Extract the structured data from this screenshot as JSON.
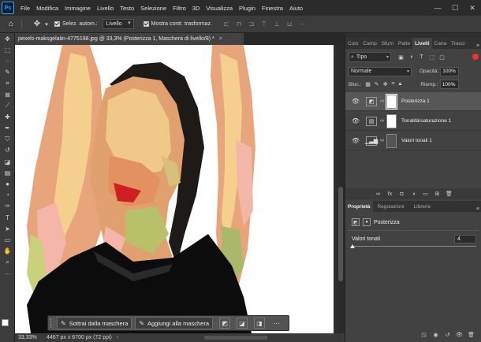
{
  "app": {
    "logo": "Ps"
  },
  "menu": [
    "File",
    "Modifica",
    "Immagine",
    "Livello",
    "Testo",
    "Selezione",
    "Filtro",
    "3D",
    "Visualizza",
    "Plugin",
    "Finestra",
    "Aiuto"
  ],
  "window_controls": {
    "minimize": "—",
    "maximize": "☐",
    "close": "✕"
  },
  "options": {
    "auto_select_label": "Selez. autom.:",
    "auto_select_value": "Livello",
    "show_transform_label": "Mostra contr. trasformaz."
  },
  "document": {
    "tab_title": "pexels-maksgelatin-4775198.jpg @ 33,3% (Posterizza 1, Maschera di livello/8) *",
    "close": "×"
  },
  "maskbar": {
    "subtract_label": "Sottrai dalla maschera",
    "add_label": "Aggiungi alla maschera",
    "more": "···"
  },
  "status": {
    "zoom": "33,33%",
    "info": "4467 px x 6700 px (72 ppi)",
    "arrow": "›"
  },
  "layers_panel": {
    "tabs": [
      "Colo",
      "Camp",
      "Sfum",
      "Patte",
      "Livelli",
      "Cana",
      "Tracci"
    ],
    "active_tab": "Livelli",
    "filter_value": "Tipo",
    "blend_mode": "Normale",
    "opacity_label": "Opacità:",
    "opacity_value": "100%",
    "lock_label": "Bloc.:",
    "fill_label": "Riemp.:",
    "fill_value": "100%",
    "layers": [
      {
        "name": "Posterizza 1",
        "selected": true
      },
      {
        "name": "Tonalità/saturazione 1",
        "selected": false
      },
      {
        "name": "Valori tonali 1",
        "selected": false
      }
    ]
  },
  "properties_panel": {
    "tabs": [
      "Proprietà",
      "Regolazioni",
      "Librerie"
    ],
    "active_tab": "Proprietà",
    "adjustment_name": "Posterizza",
    "levels_label": "Valori tonali",
    "levels_value": "4",
    "levels_min": 2,
    "levels_max": 255
  },
  "colors": {
    "accent": "#31a8ff",
    "panel": "#424242",
    "selected_row": "#575757"
  }
}
